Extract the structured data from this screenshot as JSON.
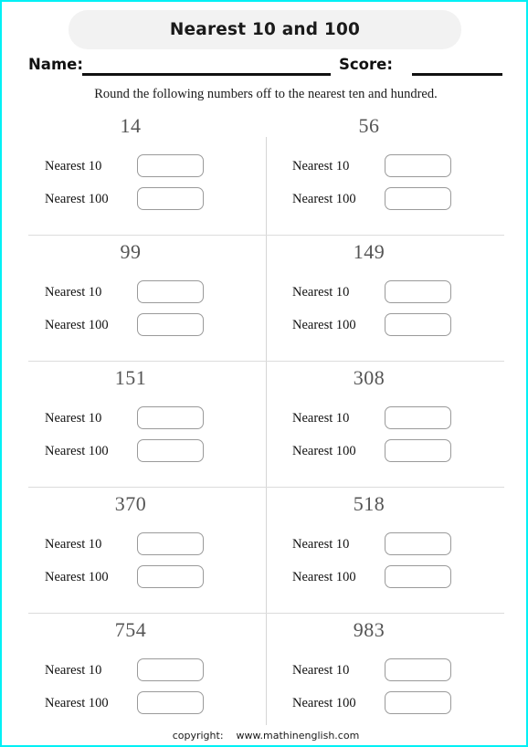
{
  "worksheet": {
    "title": "Nearest 10 and 100",
    "name_label": "Name:",
    "score_label": "Score:",
    "instruction": "Round the following numbers off to the nearest ten and hundred.",
    "footer": "copyright:    www.mathinenglish.com",
    "accent_border_color": "#00f0f5",
    "title_pill_color": "#f2f2f2",
    "number_color": "#555555",
    "divider_color": "#dcdcdc"
  },
  "labels": {
    "nearest_ten": "Nearest 10",
    "nearest_hundred": "Nearest 100"
  },
  "fields": {
    "name_value": "",
    "score_value": ""
  },
  "problems": [
    {
      "number": "14",
      "nearest_ten_answer": "",
      "nearest_hundred_answer": ""
    },
    {
      "number": "56",
      "nearest_ten_answer": "",
      "nearest_hundred_answer": ""
    },
    {
      "number": "99",
      "nearest_ten_answer": "",
      "nearest_hundred_answer": ""
    },
    {
      "number": "149",
      "nearest_ten_answer": "",
      "nearest_hundred_answer": ""
    },
    {
      "number": "151",
      "nearest_ten_answer": "",
      "nearest_hundred_answer": ""
    },
    {
      "number": "308",
      "nearest_ten_answer": "",
      "nearest_hundred_answer": ""
    },
    {
      "number": "370",
      "nearest_ten_answer": "",
      "nearest_hundred_answer": ""
    },
    {
      "number": "518",
      "nearest_ten_answer": "",
      "nearest_hundred_answer": ""
    },
    {
      "number": "754",
      "nearest_ten_answer": "",
      "nearest_hundred_answer": ""
    },
    {
      "number": "983",
      "nearest_ten_answer": "",
      "nearest_hundred_answer": ""
    }
  ]
}
